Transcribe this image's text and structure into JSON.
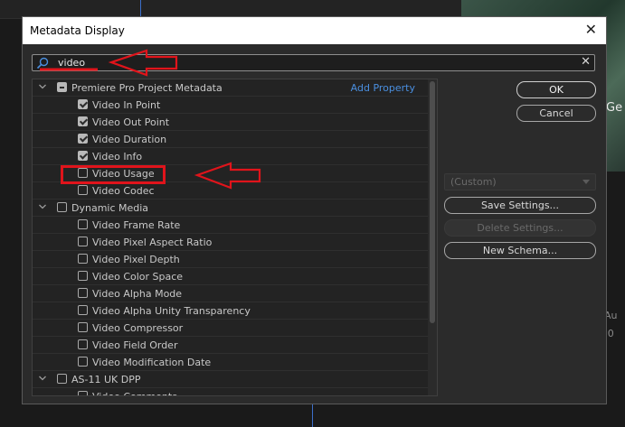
{
  "window": {
    "title": "Metadata Display",
    "close_symbol": "✕"
  },
  "background": {
    "thumbnail_text": "Ge",
    "side_text_1": "Au",
    "side_text_2": ":0"
  },
  "search": {
    "value": "video",
    "clear_symbol": "✕"
  },
  "tree": {
    "add_property_label": "Add Property",
    "groups": [
      {
        "label": "Premiere Pro Project Metadata",
        "state": "mixed",
        "items": [
          {
            "label": "Video In Point",
            "checked": true
          },
          {
            "label": "Video Out Point",
            "checked": true
          },
          {
            "label": "Video Duration",
            "checked": true
          },
          {
            "label": "Video Info",
            "checked": true
          },
          {
            "label": "Video Usage",
            "checked": false
          },
          {
            "label": "Video Codec",
            "checked": false
          }
        ]
      },
      {
        "label": "Dynamic Media",
        "state": "unchecked",
        "items": [
          {
            "label": "Video Frame Rate",
            "checked": false
          },
          {
            "label": "Video Pixel Aspect Ratio",
            "checked": false
          },
          {
            "label": "Video Pixel Depth",
            "checked": false
          },
          {
            "label": "Video Color Space",
            "checked": false
          },
          {
            "label": "Video Alpha Mode",
            "checked": false
          },
          {
            "label": "Video Alpha Unity Transparency",
            "checked": false
          },
          {
            "label": "Video Compressor",
            "checked": false
          },
          {
            "label": "Video Field Order",
            "checked": false
          },
          {
            "label": "Video Modification Date",
            "checked": false
          }
        ]
      },
      {
        "label": "AS-11 UK DPP",
        "state": "unchecked",
        "items": [
          {
            "label": "Video Comments",
            "checked": false
          }
        ]
      }
    ]
  },
  "buttons": {
    "ok": "OK",
    "cancel": "Cancel",
    "schema_value": "(Custom)",
    "save_settings": "Save Settings...",
    "delete_settings": "Delete Settings...",
    "new_schema": "New Schema..."
  },
  "colors": {
    "accent_link": "#4a8fe0",
    "annotation_red": "#e0141b"
  }
}
